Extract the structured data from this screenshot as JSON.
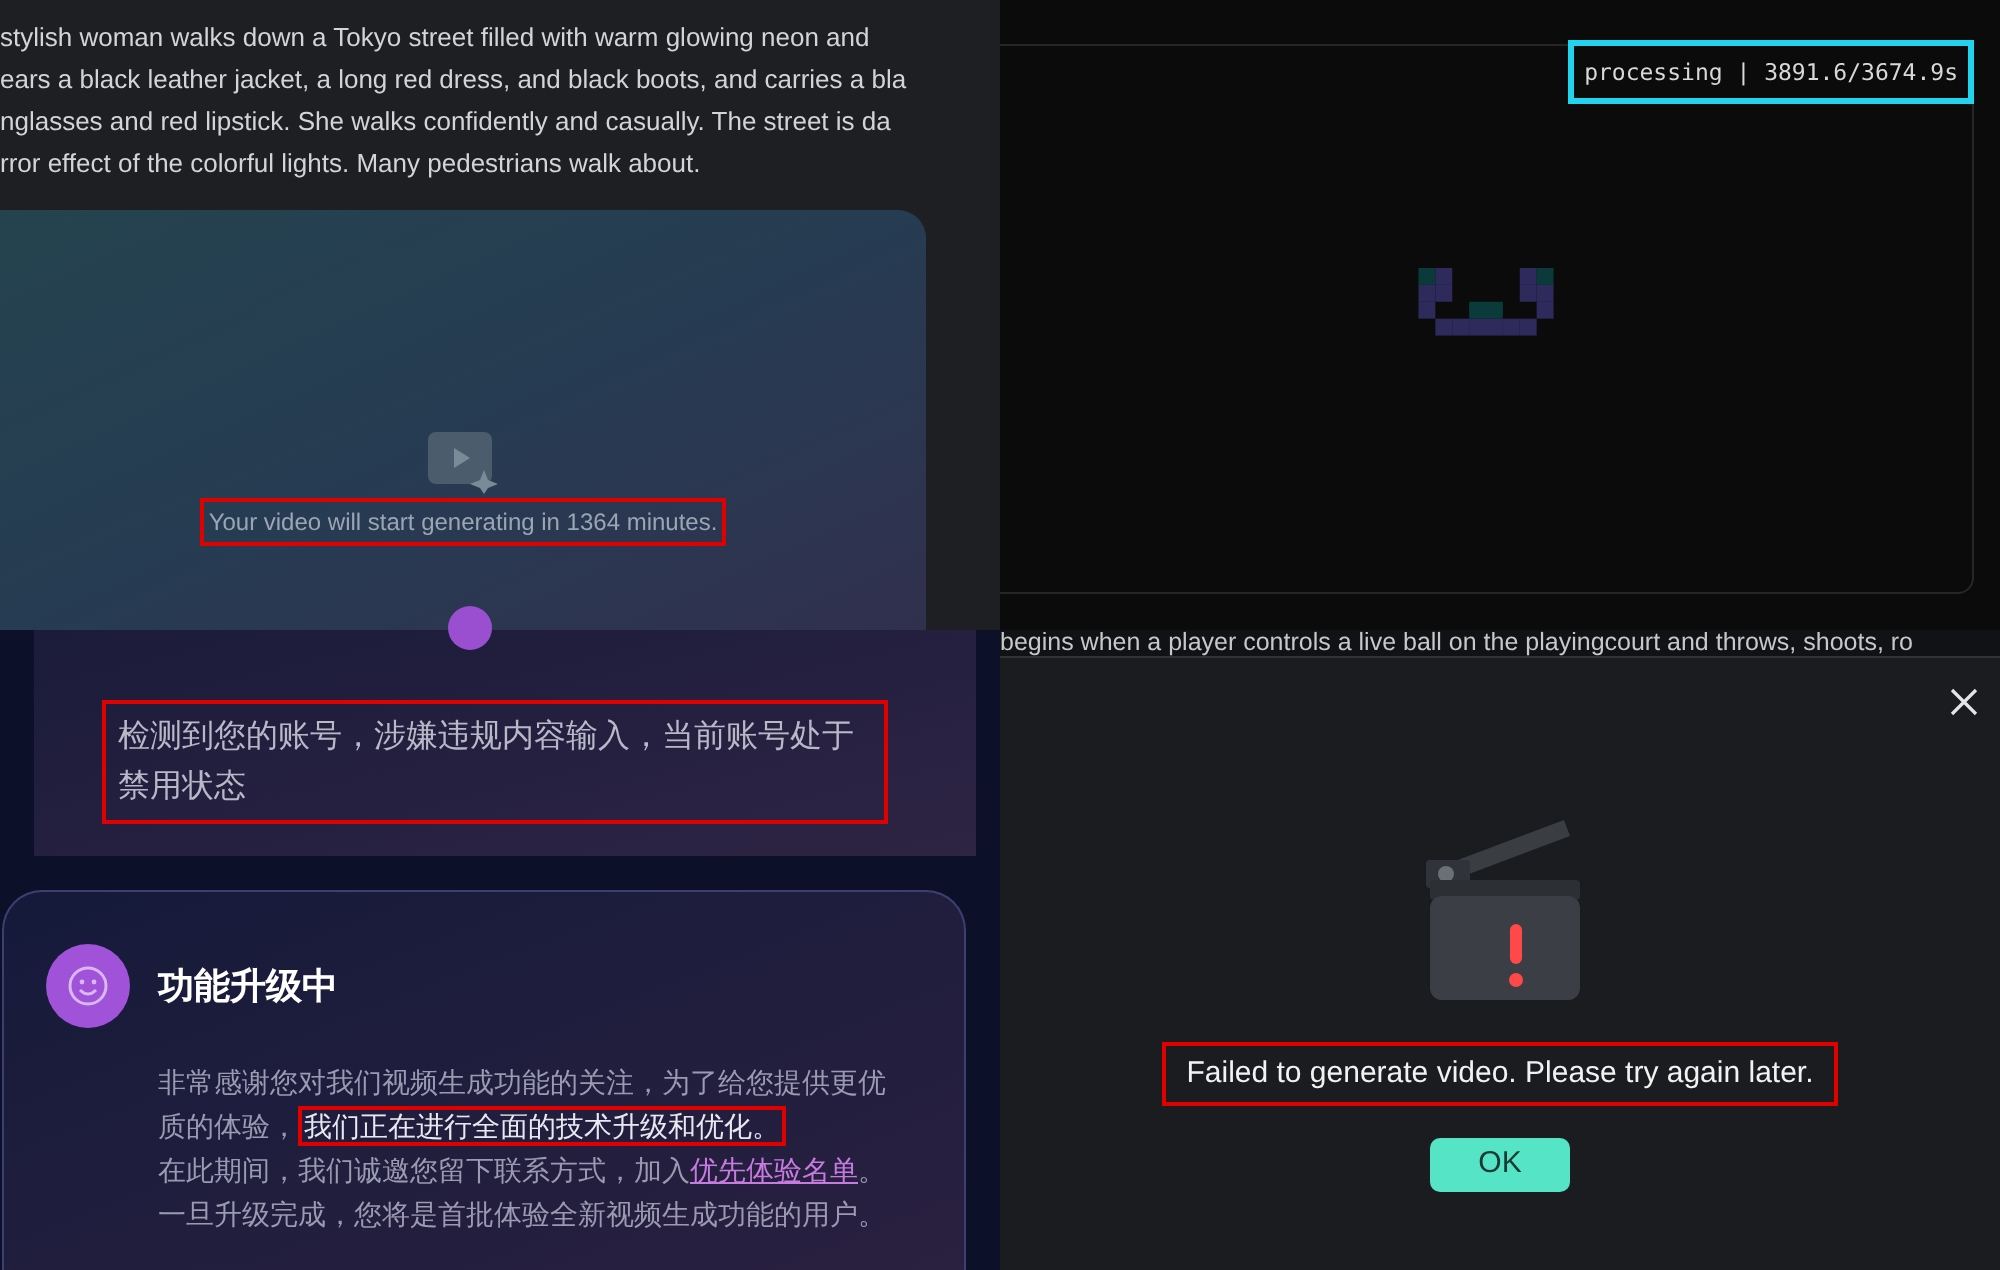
{
  "prompt_panel": {
    "prompt_lines": [
      "stylish woman walks down a Tokyo street filled with warm glowing neon and",
      "ears a black leather jacket, a long red dress, and black boots, and carries a bla",
      "nglasses and red lipstick. She walks confidently and casually. The street is da",
      "rror effect of the colorful lights. Many pedestrians walk about."
    ],
    "video_card": {
      "message": "Your video will start generating in 1364 minutes.",
      "highlighted": true
    }
  },
  "processing_panel": {
    "status": "processing | 3891.6/3674.9s",
    "highlighted": true
  },
  "ban_notice": {
    "message": "检测到您的账号，涉嫌违规内容输入，当前账号处于禁用状态",
    "highlighted": true
  },
  "upgrade_notice": {
    "title": "功能升级中",
    "lines": [
      [
        {
          "kind": "text",
          "text": "非常感谢您对我们视频生成功能的关注，为了给您提供更优质的体验，"
        },
        {
          "kind": "highlight",
          "text": "我们正在进行全面的技术升级和优化。"
        }
      ],
      [
        {
          "kind": "text",
          "text": "在此期间，我们诚邀您留下联系方式，加入"
        },
        {
          "kind": "link",
          "text": "优先体验名单"
        },
        {
          "kind": "text",
          "text": "。"
        }
      ],
      [
        {
          "kind": "text",
          "text": "一旦升级完成，您将是首批体验全新视频生成功能的用户。"
        }
      ]
    ]
  },
  "error_dialog": {
    "prompt_line": "begins when a player controls a live ball on the playingcourt and throws, shoots, ro",
    "message": "Failed to generate video. Please try again later.",
    "highlighted": true,
    "buttons": [
      "OK"
    ]
  }
}
